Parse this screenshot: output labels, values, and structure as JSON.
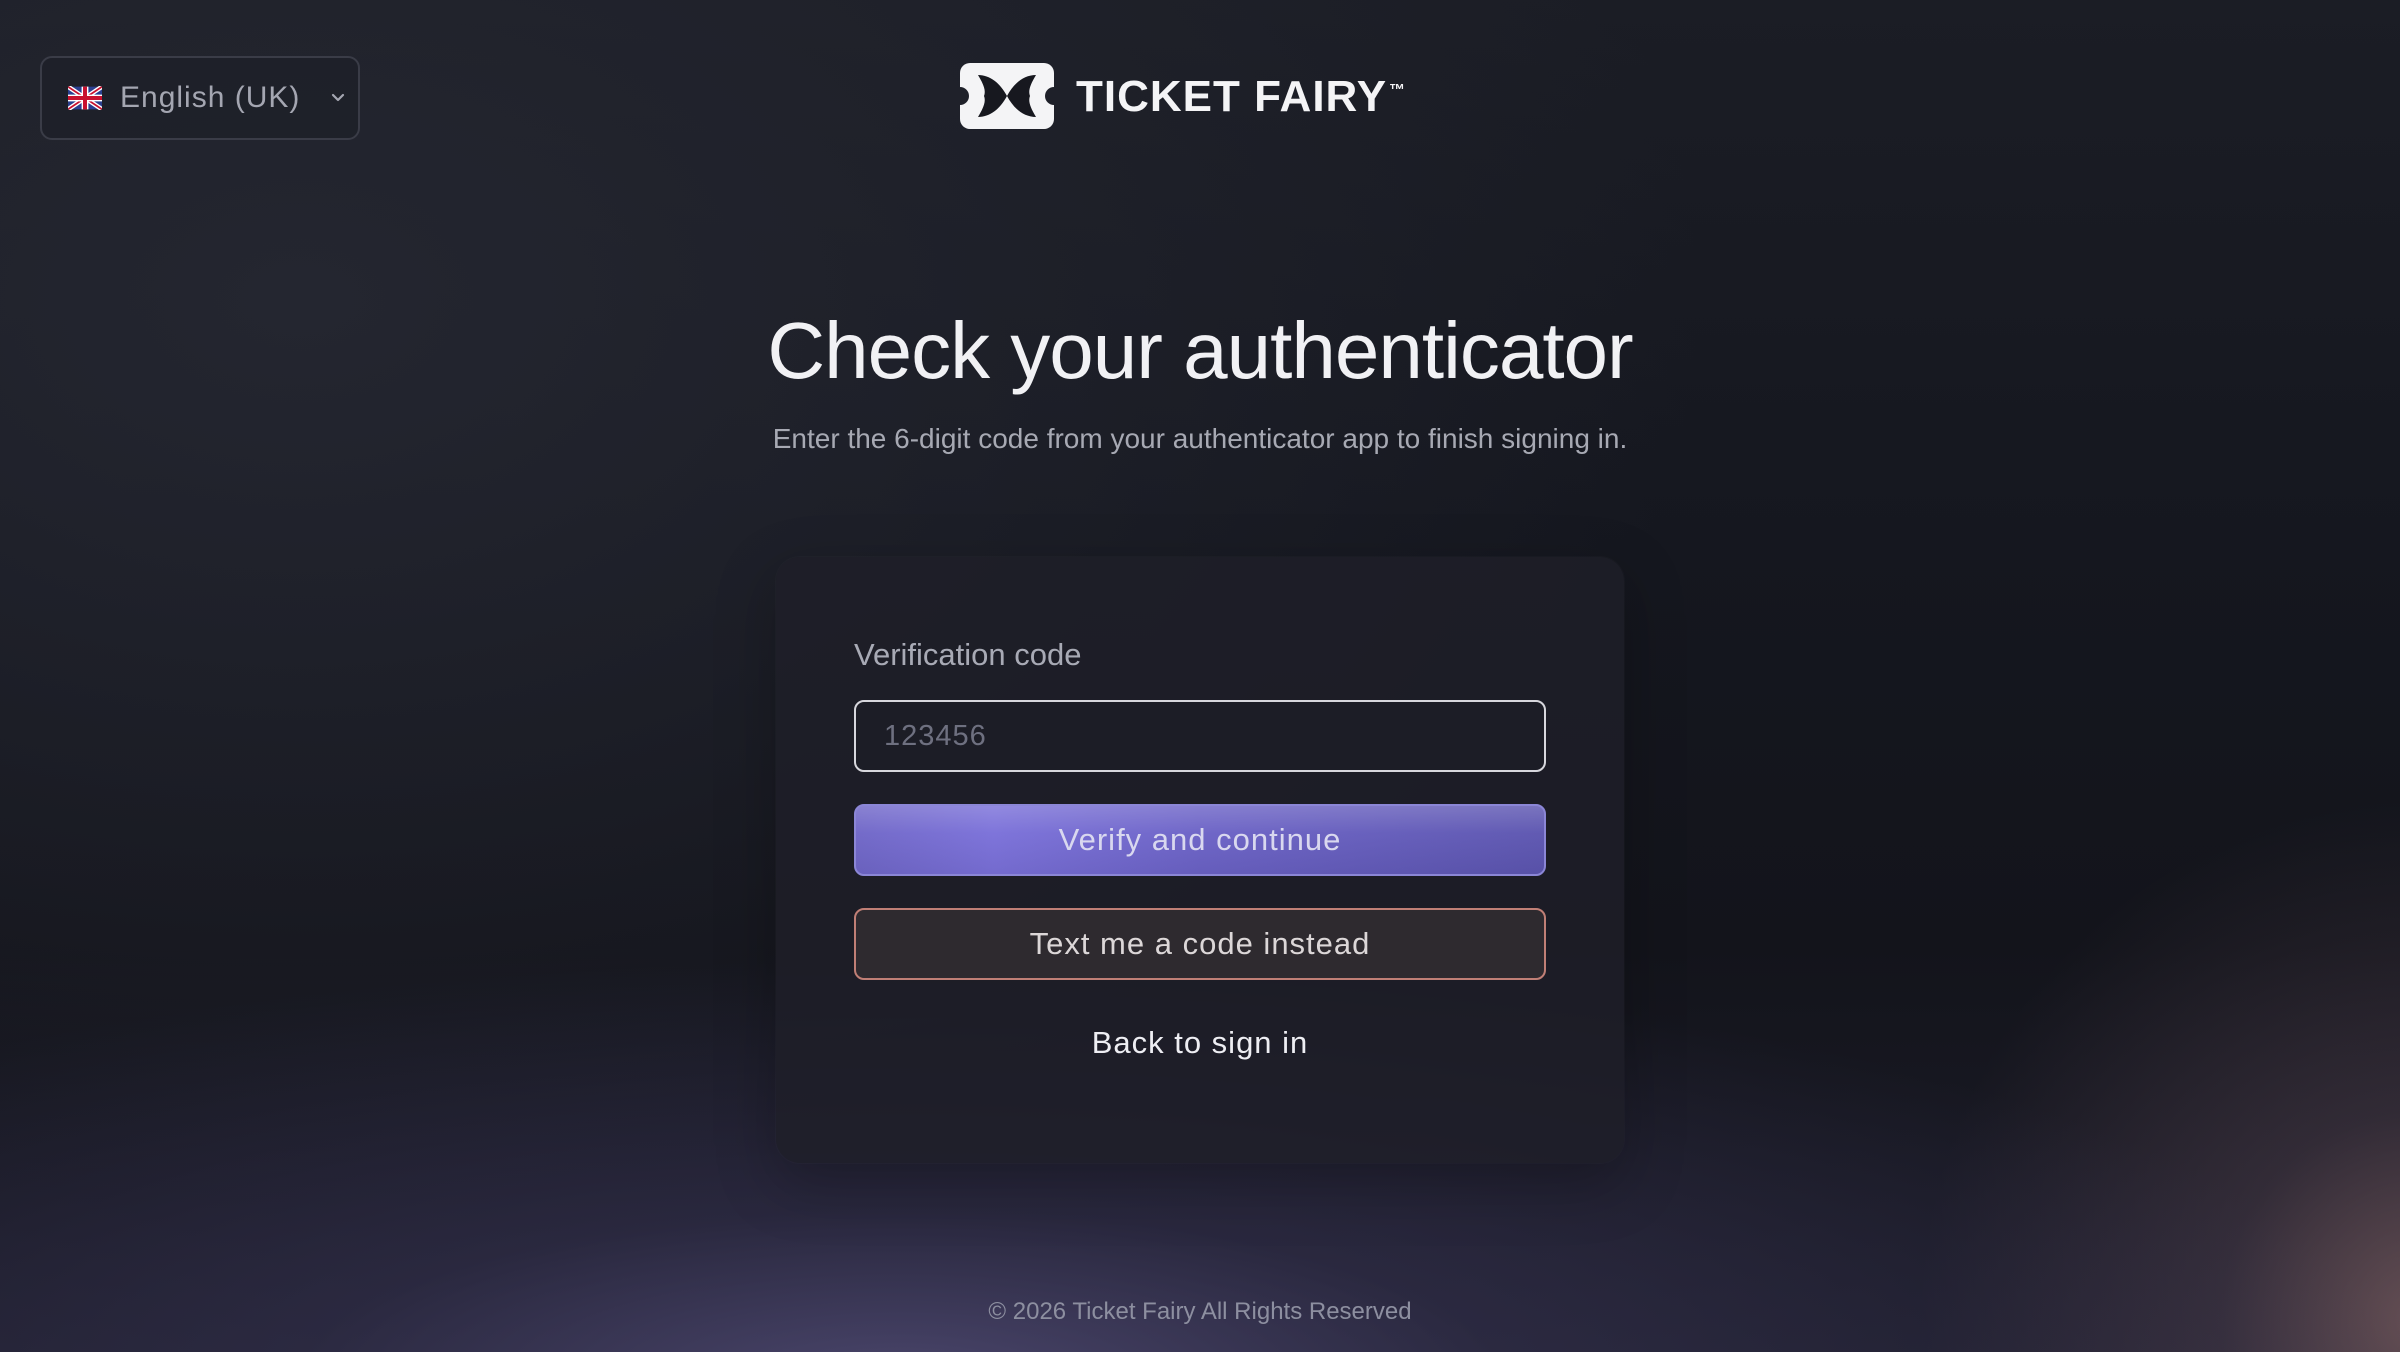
{
  "language_selector": {
    "flag_icon": "uk-flag-icon",
    "label": "English (UK)",
    "dropdown_icon": "chevron-down-icon"
  },
  "brand": {
    "logo_icon": "ticket-fairy-logo-icon",
    "name": "TICKET FAIRY",
    "trademark": "™"
  },
  "page": {
    "title": "Check your authenticator",
    "subtitle": "Enter the 6-digit code from your authenticator app to finish signing in."
  },
  "form": {
    "code_label": "Verification code",
    "code_value": "",
    "code_placeholder": "123456",
    "verify_button": "Verify and continue",
    "sms_button": "Text me a code instead",
    "back_link": "Back to sign in"
  },
  "footer": {
    "copyright": "© 2026 Ticket Fairy All Rights Reserved"
  },
  "colors": {
    "primary_button": "#6f66c7",
    "secondary_button_border": "#c07f76",
    "background": "#15171f"
  }
}
